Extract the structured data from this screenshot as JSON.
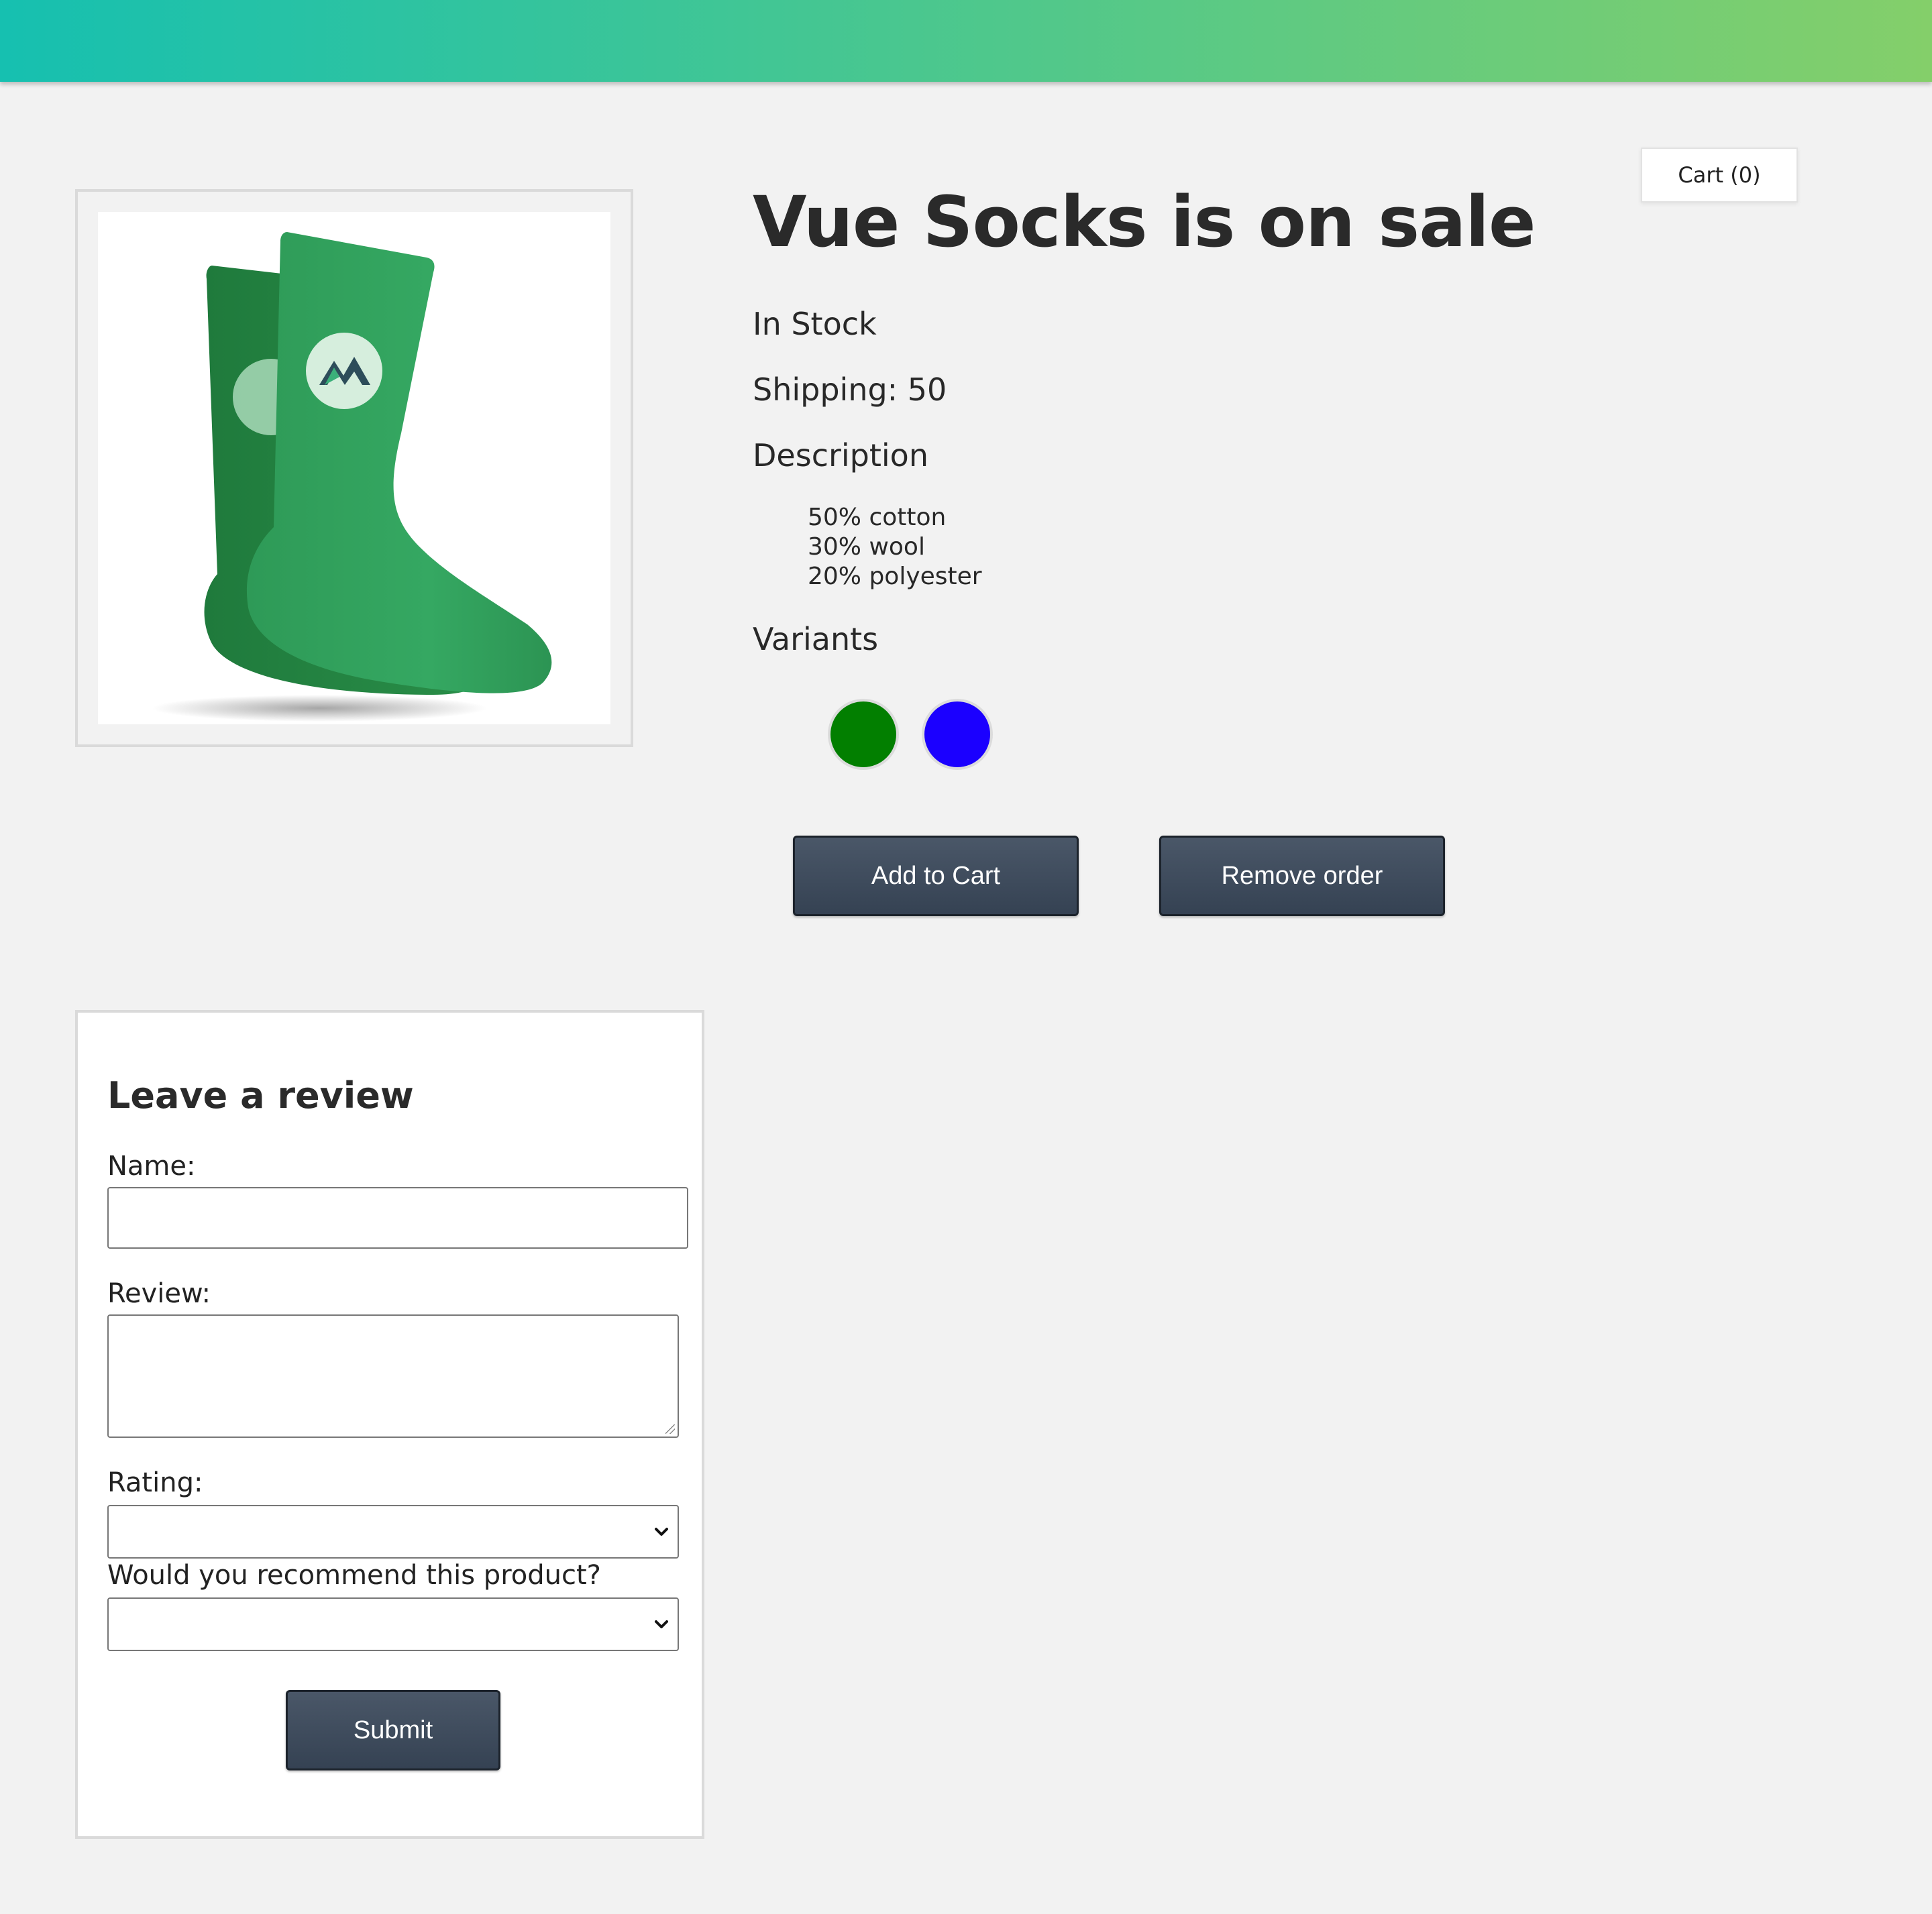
{
  "header": {
    "gradient_start": "#16c0b0",
    "gradient_end": "#84cf6a"
  },
  "cart": {
    "label": "Cart (0)"
  },
  "product": {
    "image_alt": "green socks",
    "title": "Vue Socks is on sale",
    "stock_status": "In Stock",
    "shipping": "Shipping: 50",
    "description_heading": "Description",
    "details": [
      "50% cotton",
      "30% wool",
      "20% polyester"
    ],
    "variants_heading": "Variants",
    "variants": [
      {
        "color": "#027f00",
        "icon": "green-swatch"
      },
      {
        "color": "#1b00ff",
        "icon": "blue-swatch"
      }
    ],
    "add_to_cart_label": "Add to Cart",
    "remove_order_label": "Remove order"
  },
  "review_form": {
    "heading": "Leave a review",
    "name_label": "Name:",
    "name_value": "",
    "review_label": "Review:",
    "review_value": "",
    "rating_label": "Rating:",
    "rating_value": "",
    "recommend_label": "Would you recommend this product?",
    "recommend_value": "",
    "submit_label": "Submit"
  }
}
